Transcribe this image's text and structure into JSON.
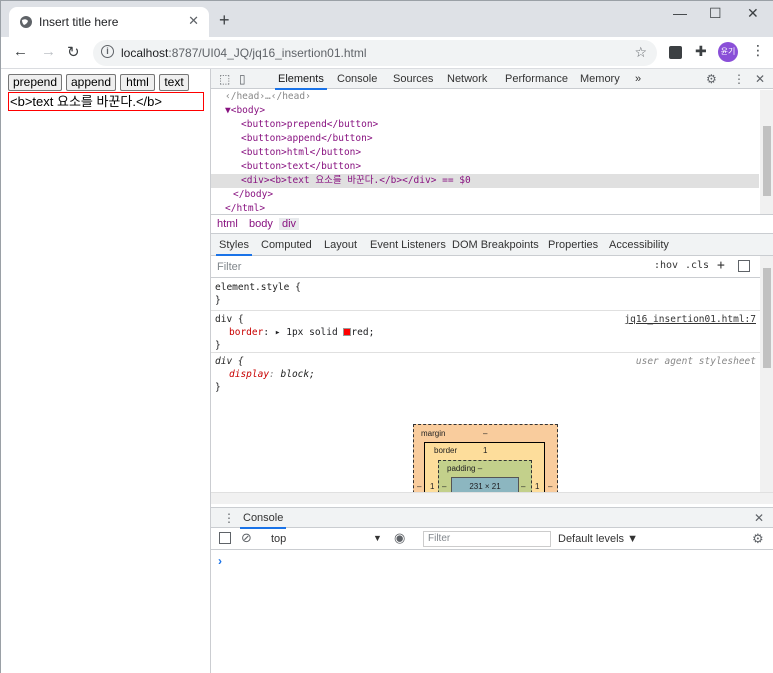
{
  "browser": {
    "tab_title": "Insert title here",
    "tab_close": "✕",
    "new_tab": "+",
    "window_controls": [
      "—",
      "☐",
      "✕"
    ],
    "url_host": "localhost",
    "url_path": ":8787/UI04_JQ/jq16_insertion01.html",
    "profile_label": "윤기"
  },
  "page": {
    "buttons": [
      "prepend",
      "append",
      "html",
      "text"
    ],
    "div_text": "<b>text 요소를 바꾼다.</b>"
  },
  "devtools": {
    "tabs": [
      "Elements",
      "Console",
      "Sources",
      "Network",
      "Performance",
      "Memory",
      "»"
    ],
    "active_tab": "Elements",
    "dom_lines": [
      {
        "indent": 1,
        "html": "‹/head›…‹/head›",
        "dim": true
      },
      {
        "indent": 1,
        "html": "▼<body>"
      },
      {
        "indent": 3,
        "html": "<button>prepend</button>"
      },
      {
        "indent": 3,
        "html": "<button>append</button>"
      },
      {
        "indent": 3,
        "html": "<button>html</button>"
      },
      {
        "indent": 3,
        "html": "<button>text</button>"
      },
      {
        "indent": 3,
        "html": "<div><b>text 요소를 바꾼다.</b></div> == $0",
        "selected": true
      },
      {
        "indent": 2,
        "html": "</body>"
      },
      {
        "indent": 1,
        "html": "</html>"
      }
    ],
    "breadcrumbs": [
      "html",
      "body",
      "div"
    ],
    "subtabs": [
      "Styles",
      "Computed",
      "Layout",
      "Event Listeners",
      "DOM Breakpoints",
      "Properties",
      "Accessibility"
    ],
    "filter_placeholder": "Filter",
    "filter_hov": ":hov",
    "filter_cls": ".cls",
    "filter_add": "+",
    "rules": {
      "element_style_open": "element.style {",
      "close": "}",
      "div_open": "div {",
      "div_prop": "border",
      "div_value_pre": "▸ 1px solid ",
      "div_value_post": "red;",
      "div_source": "jq16_insertion01.html:7",
      "ua_open": "div {",
      "ua_prop": "display",
      "ua_value": "block;",
      "ua_source": "user agent stylesheet"
    },
    "box_model": {
      "margin_label": "margin",
      "margin_value": "–",
      "border_label": "border",
      "border_value": "1",
      "padding_label": "padding –",
      "content": "231 × 21",
      "side_dash": "–",
      "side_one": "1"
    },
    "drawer": {
      "tab": "Console",
      "context": "top",
      "filter_placeholder": "Filter",
      "levels": "Default levels ▼",
      "prompt": "›"
    }
  }
}
